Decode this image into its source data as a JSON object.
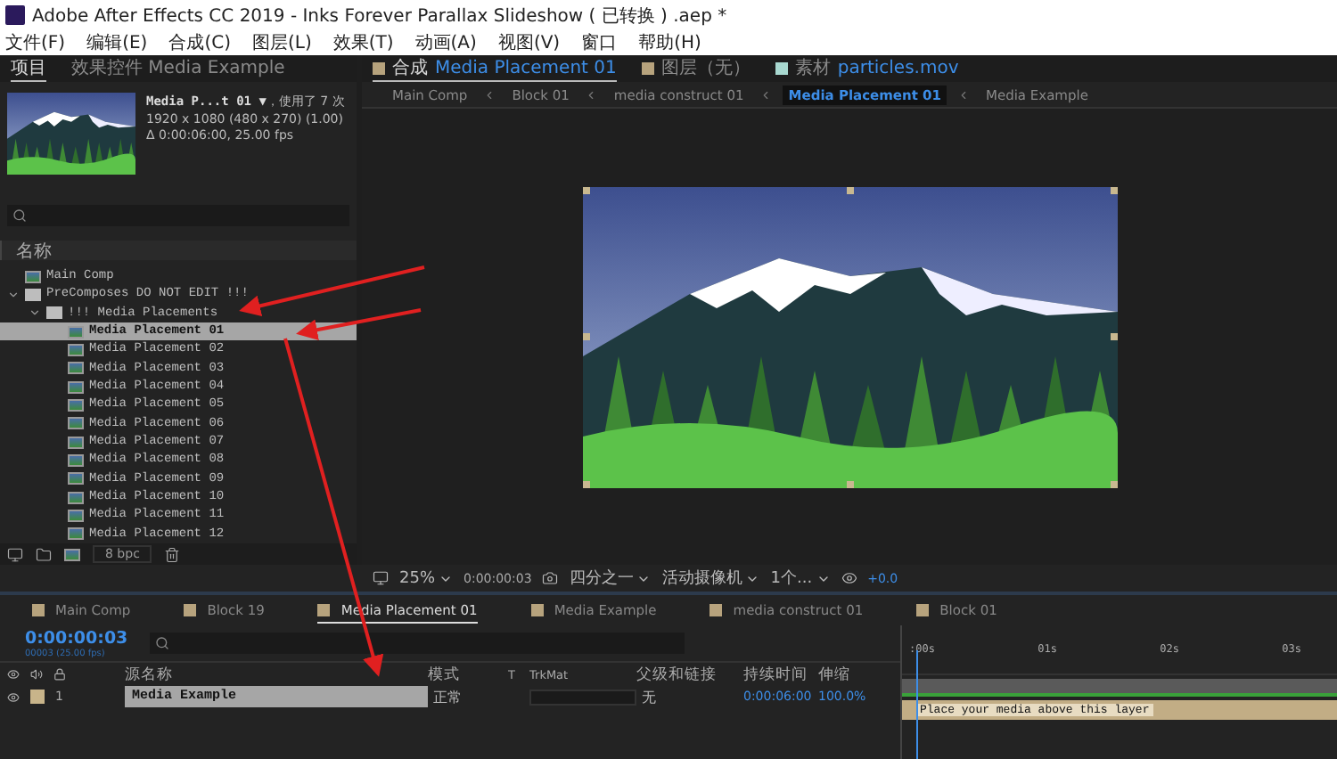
{
  "window": {
    "title": "Adobe After Effects CC 2019 - Inks Forever Parallax Slideshow ( 已转换 ) .aep *"
  },
  "menu": [
    "文件(F)",
    "编辑(E)",
    "合成(C)",
    "图层(L)",
    "效果(T)",
    "动画(A)",
    "视图(V)",
    "窗口",
    "帮助(H)"
  ],
  "project_panel": {
    "tabs": [
      {
        "label": "项目",
        "selected": true
      },
      {
        "label": "效果控件 Media Example",
        "selected": false
      }
    ],
    "preview": {
      "name": "Media P...t 01 ▼",
      "usage": "，使用了 7 次",
      "dimensions": "1920 x 1080  (480 x 270) (1.00)",
      "duration": "Δ 0:00:06:00, 25.00 fps"
    },
    "column": "名称",
    "tree": [
      {
        "label": "Main Comp",
        "kind": "comp",
        "selected": false
      },
      {
        "label": "PreComposes DO NOT EDIT !!!",
        "kind": "folder",
        "expanded": true,
        "selected": false,
        "children": [
          {
            "label": "!!! Media Placements",
            "kind": "folder",
            "expanded": true,
            "selected": false,
            "children": [
              {
                "label": "Media Placement 01",
                "kind": "comp",
                "selected": true
              },
              {
                "label": "Media Placement 02",
                "kind": "comp",
                "selected": false
              },
              {
                "label": "Media Placement 03",
                "kind": "comp",
                "selected": false
              },
              {
                "label": "Media Placement 04",
                "kind": "comp",
                "selected": false
              },
              {
                "label": "Media Placement 05",
                "kind": "comp",
                "selected": false
              },
              {
                "label": "Media Placement 06",
                "kind": "comp",
                "selected": false
              },
              {
                "label": "Media Placement 07",
                "kind": "comp",
                "selected": false
              },
              {
                "label": "Media Placement 08",
                "kind": "comp",
                "selected": false
              },
              {
                "label": "Media Placement 09",
                "kind": "comp",
                "selected": false
              },
              {
                "label": "Media Placement 10",
                "kind": "comp",
                "selected": false
              },
              {
                "label": "Media Placement 11",
                "kind": "comp",
                "selected": false
              },
              {
                "label": "Media Placement 12",
                "kind": "comp",
                "selected": false
              }
            ]
          }
        ]
      }
    ],
    "bit_depth": "8 bpc"
  },
  "comp_panel": {
    "tabs": [
      {
        "label": "合成",
        "value": "Media Placement 01",
        "selected": true
      },
      {
        "label": "图层（无）",
        "selected": false
      },
      {
        "label": "素材",
        "value": "particles.mov",
        "selected": false
      }
    ],
    "breadcrumbs": [
      {
        "label": "Main Comp",
        "selected": false
      },
      {
        "label": "Block 01",
        "selected": false
      },
      {
        "label": "media construct 01",
        "selected": false
      },
      {
        "label": "Media Placement 01",
        "selected": true
      },
      {
        "label": "Media Example",
        "selected": false
      }
    ],
    "toolbar": {
      "zoom": "25%",
      "time": "0:00:00:03",
      "resolution": "四分之一",
      "camera": "活动摄像机",
      "views": "1个...",
      "exposure": "+0.0"
    }
  },
  "timeline": {
    "tabs": [
      {
        "label": "Main Comp",
        "selected": false
      },
      {
        "label": "Block 19",
        "selected": false
      },
      {
        "label": "Media Placement 01",
        "selected": true
      },
      {
        "label": "Media Example",
        "selected": false
      },
      {
        "label": "media construct 01",
        "selected": false
      },
      {
        "label": "Block 01",
        "selected": false
      }
    ],
    "timecode": "0:00:00:03",
    "frame": "00003 (25.00 fps)",
    "columns": [
      "源名称",
      "模式",
      "T",
      "TrkMat",
      "父级和链接",
      "持续时间",
      "伸缩"
    ],
    "ruler": [
      ":00s",
      "01s",
      "02s",
      "03s"
    ],
    "layers": [
      {
        "index": "1",
        "name": "Media Example",
        "mode": "正常",
        "parent": "无",
        "duration": "0:00:06:00",
        "stretch": "100.0%",
        "color": "#c8b48a",
        "selected": true,
        "bar_text": "Place your media above this layer"
      }
    ]
  }
}
